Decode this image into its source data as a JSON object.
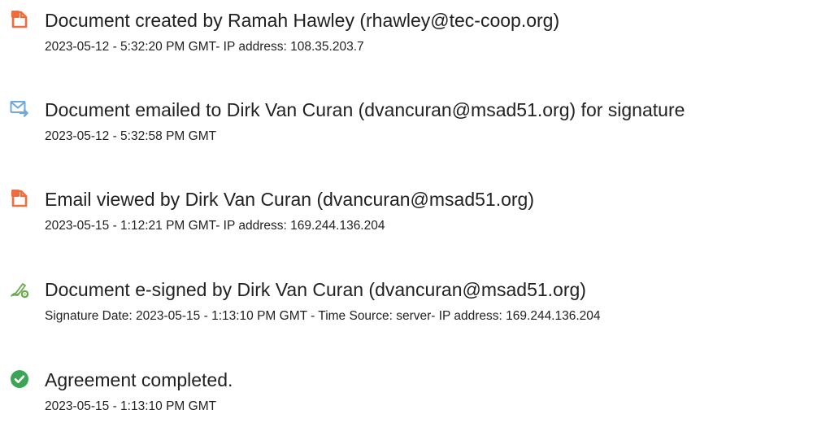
{
  "events": [
    {
      "icon": "document-created-icon",
      "title": "Document created by Ramah Hawley (rhawley@tec-coop.org)",
      "detail": "2023-05-12 - 5:32:20 PM GMT- IP address: 108.35.203.7"
    },
    {
      "icon": "envelope-sent-icon",
      "title": "Document emailed to Dirk Van Curan (dvancuran@msad51.org) for signature",
      "detail": "2023-05-12 - 5:32:58 PM GMT"
    },
    {
      "icon": "document-viewed-icon",
      "title": "Email viewed by Dirk Van Curan (dvancuran@msad51.org)",
      "detail": "2023-05-15 - 1:12:21 PM GMT- IP address: 169.244.136.204"
    },
    {
      "icon": "pen-signature-icon",
      "title": "Document e-signed by Dirk Van Curan (dvancuran@msad51.org)",
      "detail": "Signature Date: 2023-05-15 - 1:13:10 PM GMT - Time Source: server- IP address: 169.244.136.204"
    },
    {
      "icon": "checkmark-circle-icon",
      "title": "Agreement completed.",
      "detail": "2023-05-15 - 1:13:10 PM GMT"
    }
  ],
  "colors": {
    "document_orange": "#f26b3a",
    "envelope_blue": "#6fa8dc",
    "pen_green": "#6aa84f",
    "check_green": "#3aa655"
  }
}
